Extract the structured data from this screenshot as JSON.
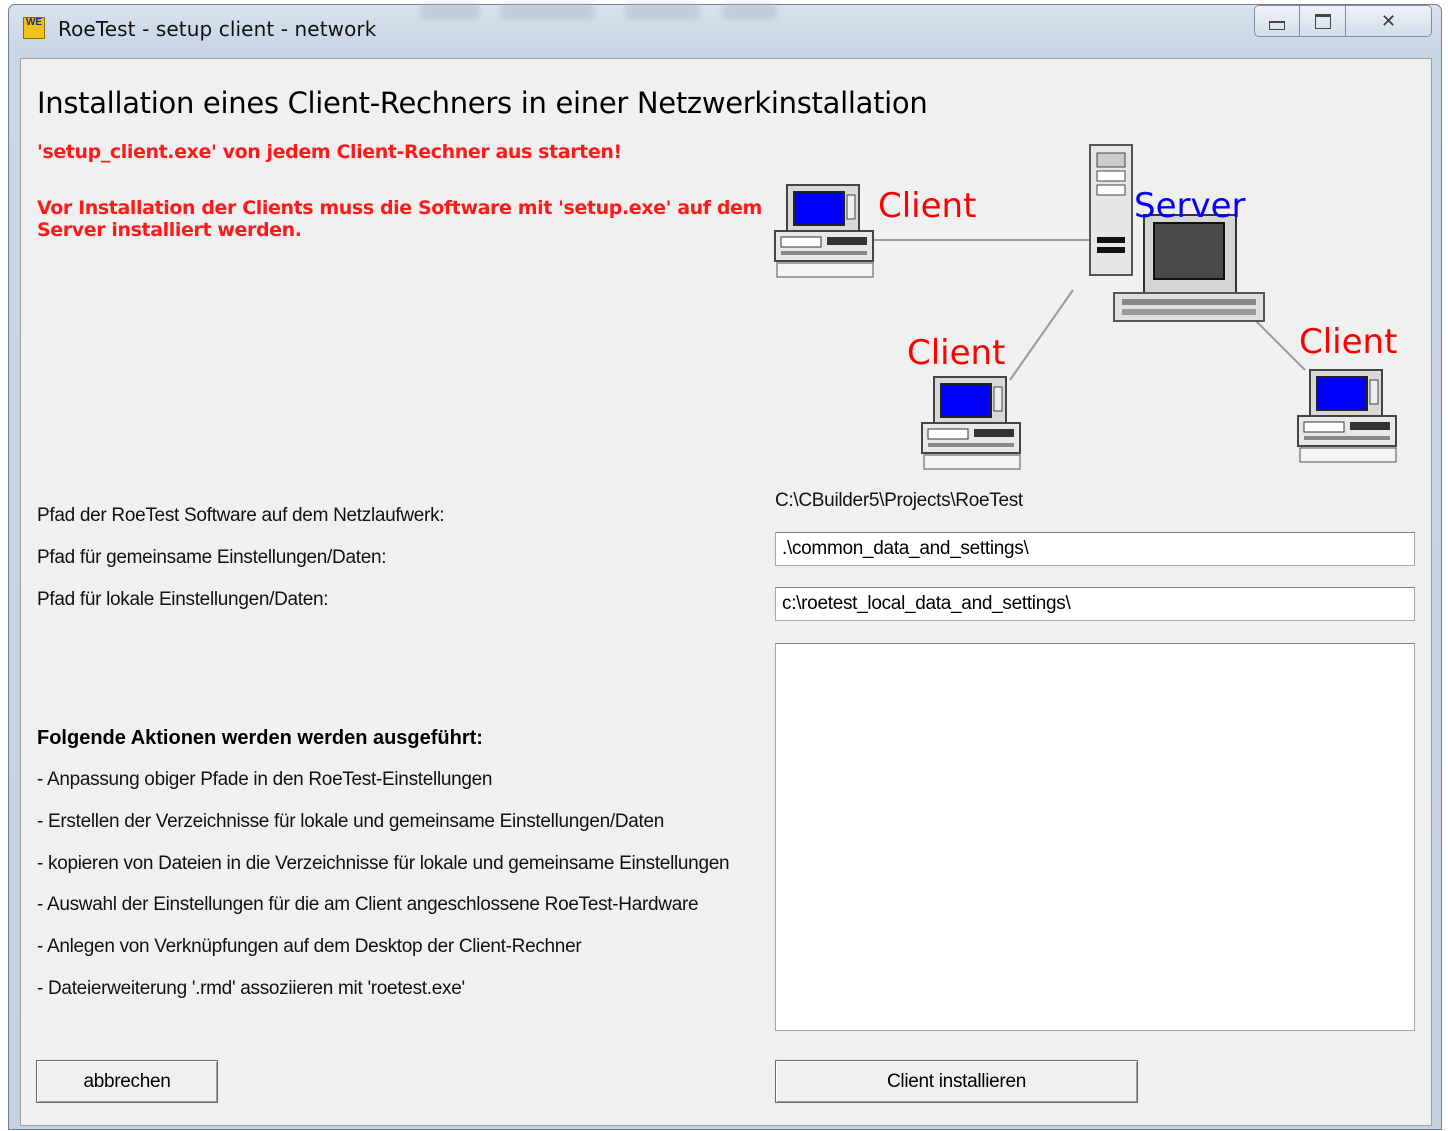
{
  "window": {
    "title": "RoeTest - setup client - network",
    "app_icon": "roetest-app-icon",
    "app_icon_text": "WE",
    "controls": [
      "minimize-icon",
      "maximize-icon",
      "close-icon"
    ]
  },
  "main": {
    "heading": "Installation eines Client-Rechners in einer Netzwerkinstallation",
    "warning_line1": "'setup_client.exe' von jedem Client-Rechner aus starten!",
    "warning_line2": "Vor Installation der Clients muss die Software  mit 'setup.exe' auf dem",
    "warning_line3": "Server installiert werden."
  },
  "diagram": {
    "server_label": "Server",
    "client_labels": [
      "Client",
      "Client",
      "Client"
    ],
    "colors": {
      "client": "#ff0000",
      "server": "#0000ff",
      "screen": "#0000ff"
    }
  },
  "paths": {
    "software_label": "Pfad der RoeTest Software auf dem Netzlaufwerk:",
    "software_value": "C:\\CBuilder5\\Projects\\RoeTest",
    "common_label": "Pfad für gemeinsame Einstellungen/Daten:",
    "common_value": ".\\common_data_and_settings\\",
    "local_label": "Pfad für lokale Einstellungen/Daten:",
    "local_value": "c:\\roetest_local_data_and_settings\\"
  },
  "actions": {
    "heading": "Folgende Aktionen werden werden ausgeführt:",
    "items": [
      "- Anpassung obiger Pfade in den RoeTest-Einstellungen",
      "- Erstellen der Verzeichnisse für lokale und gemeinsame Einstellungen/Daten",
      "- kopieren von Dateien in die Verzeichnisse für lokale und gemeinsame  Einstellungen",
      "- Auswahl der Einstellungen für die am Client angeschlossene RoeTest-Hardware",
      "- Anlegen von Verknüpfungen auf dem Desktop der Client-Rechner",
      "- Dateierweiterung '.rmd' assoziieren mit 'roetest.exe'"
    ]
  },
  "buttons": {
    "cancel": "abbrechen",
    "install": "Client installieren"
  }
}
